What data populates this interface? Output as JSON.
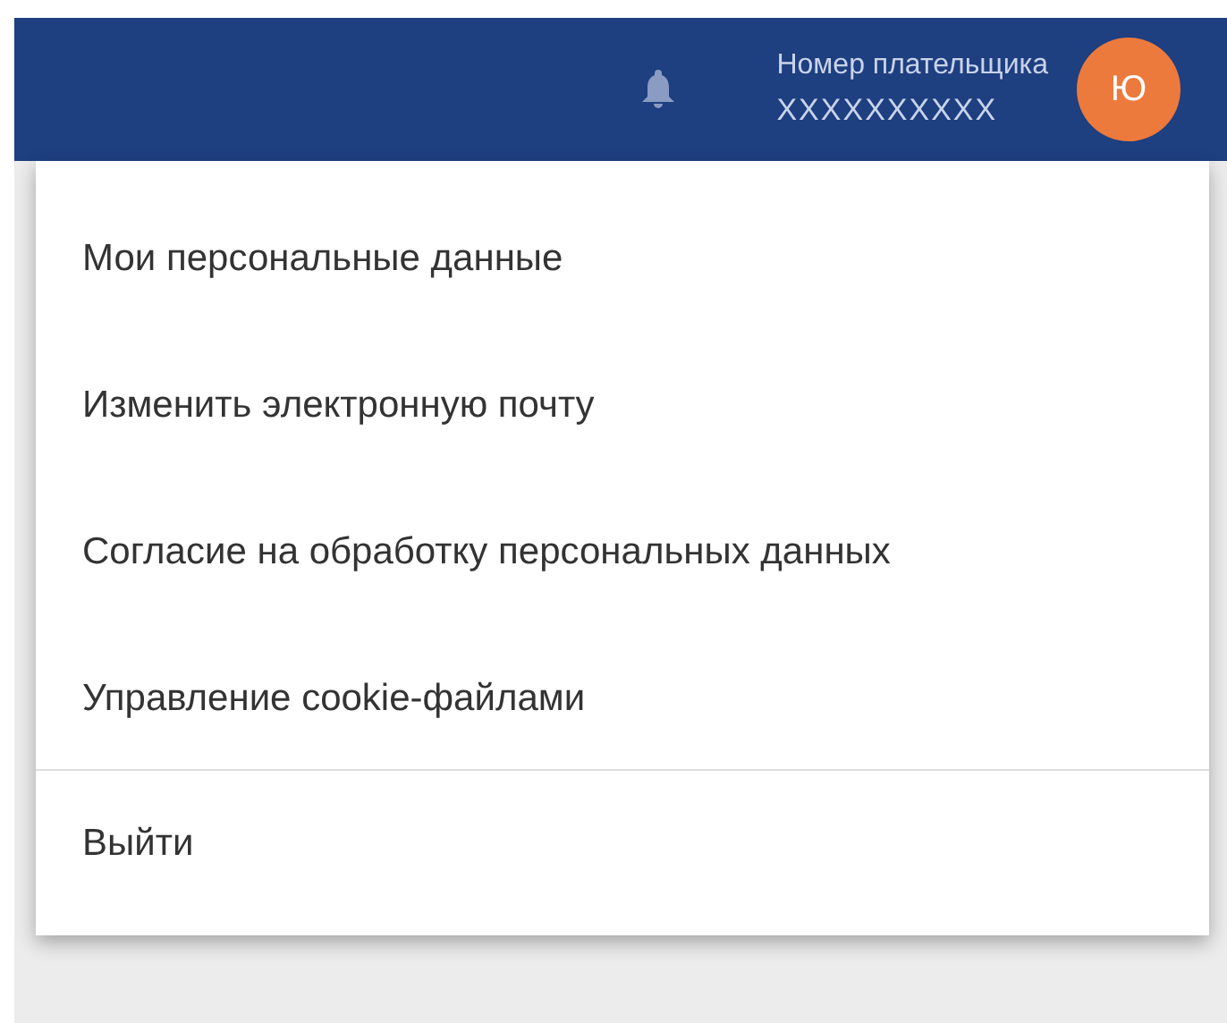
{
  "header": {
    "payer_label": "Номер плательщика",
    "payer_number": "XXXXXXXXXX",
    "avatar_letter": "Ю"
  },
  "menu": {
    "sections": [
      {
        "items": [
          "Мои персональные данные",
          "Изменить электронную почту",
          "Согласие на обработку персональных данных",
          "Управление cookie-файлами"
        ]
      },
      {
        "items": [
          "Выйти"
        ]
      }
    ]
  }
}
